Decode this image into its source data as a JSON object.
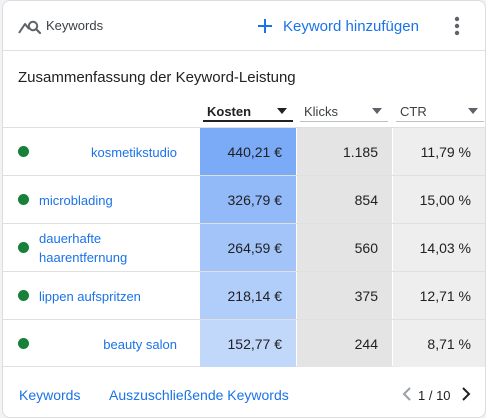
{
  "header": {
    "title": "Keywords",
    "add_label": "Keyword hinzufügen",
    "icon": "keyword-search-icon"
  },
  "section_title": "Zusammenfassung der Keyword-Leistung",
  "columns": {
    "cost": "Kosten",
    "clicks": "Klicks",
    "ctr": "CTR",
    "sorted_by": "Kosten"
  },
  "colors": {
    "accent": "#1a73e8",
    "status_enabled": "#188038",
    "cost_scale": [
      "#7baaf7",
      "#92b9f8",
      "#a3c4f9",
      "#b1cdfa",
      "#c2d8fb"
    ]
  },
  "rows": [
    {
      "keyword": "kosmetikstudio",
      "align": "right",
      "status": "enabled",
      "cost": "440,21 €",
      "clicks": "1.185",
      "ctr": "11,79 %"
    },
    {
      "keyword": "microblading",
      "align": "left",
      "status": "enabled",
      "cost": "326,79 €",
      "clicks": "854",
      "ctr": "15,00 %"
    },
    {
      "keyword": "dauerhafte haarentfernung",
      "align": "left",
      "status": "enabled",
      "cost": "264,59 €",
      "clicks": "560",
      "ctr": "14,03 %"
    },
    {
      "keyword": "lippen aufspritzen",
      "align": "left",
      "status": "enabled",
      "cost": "218,14 €",
      "clicks": "375",
      "ctr": "12,71 %"
    },
    {
      "keyword": "beauty salon",
      "align": "right",
      "status": "enabled",
      "cost": "152,77 €",
      "clicks": "244",
      "ctr": "8,71 %"
    }
  ],
  "footer": {
    "link_keywords": "Keywords",
    "link_negative": "Auszuschließende Keywords",
    "pagination": "1 / 10"
  }
}
